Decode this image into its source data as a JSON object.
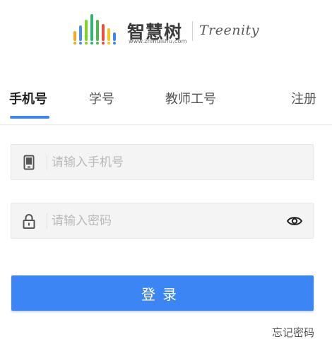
{
  "brand": {
    "name_cn": "智慧树",
    "url": "www.zhihuishu.com",
    "name_en": "Treenity",
    "bar_colors": [
      "#f5a623",
      "#4a90e2",
      "#7ed321",
      "#2bb673",
      "#50b848",
      "#e94e3c",
      "#f5c518",
      "#3b86f4"
    ]
  },
  "tabs": [
    {
      "label": "手机号",
      "active": true
    },
    {
      "label": "学号",
      "active": false
    },
    {
      "label": "教师工号",
      "active": false
    }
  ],
  "register_label": "注册",
  "form": {
    "phone_placeholder": "请输入手机号",
    "phone_value": "",
    "password_placeholder": "请输入密码",
    "password_value": "",
    "phone_icon": "phone-icon",
    "lock_icon": "lock-icon",
    "eye_icon": "eye-icon"
  },
  "login_label": "登录",
  "forgot_label": "忘记密码",
  "colors": {
    "accent": "#3b86f4",
    "input_bg": "#f4f4f4"
  }
}
